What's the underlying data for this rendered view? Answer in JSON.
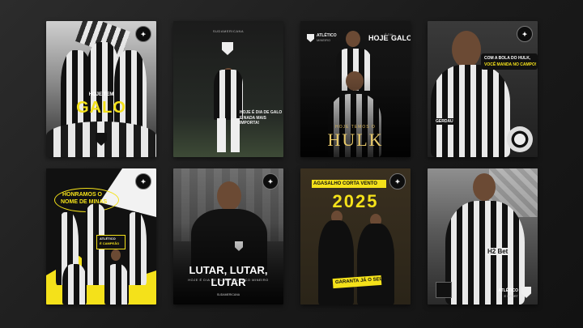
{
  "cards": {
    "c1": {
      "line1": "HOJE TEM",
      "line2": "GALO"
    },
    "c2": {
      "brand": "SUDAMERICANA",
      "line1": "HOJE É DIA DE GALO",
      "line2": "E NADA MAIS IMPORTA!"
    },
    "c3": {
      "brand": "ATLÉTICO",
      "brand_sub": "MINEIRO",
      "title_a": "HOJE",
      "title_b": "É DIA",
      "title_c": "GALO",
      "sub": "HOJE TEMOS O",
      "big": "HULK"
    },
    "c4": {
      "line1": "COM A BOLA DO HULK,",
      "line2": "VOCÊ MANDA NO CAMPO!",
      "sponsor": "GERDAU"
    },
    "c5": {
      "bubble1": "HONRAMOS O",
      "bubble2": "NOME DE MINAS",
      "tag1": "ATLÉTICO",
      "tag2": "É CAMPEÃO"
    },
    "c6": {
      "title": "LUTAR, LUTAR, LUTAR",
      "sub": "HOJE É DIA DE CLUBE ATLÉTICO MINEIRO",
      "brand": "SUDAMERICANA"
    },
    "c7": {
      "title": "AGASALHO CORTA VENTO",
      "year": "2025",
      "cta": "GARANTA JÁ O SEU!"
    },
    "c8": {
      "sponsor": "H2 Bet",
      "brand": "ATLÉTICO",
      "brand_sub": "E SPORT"
    }
  },
  "colors": {
    "yellow": "#f4e11a",
    "gold": "#d9b65c",
    "black": "#111111",
    "white": "#e9e9e9"
  }
}
